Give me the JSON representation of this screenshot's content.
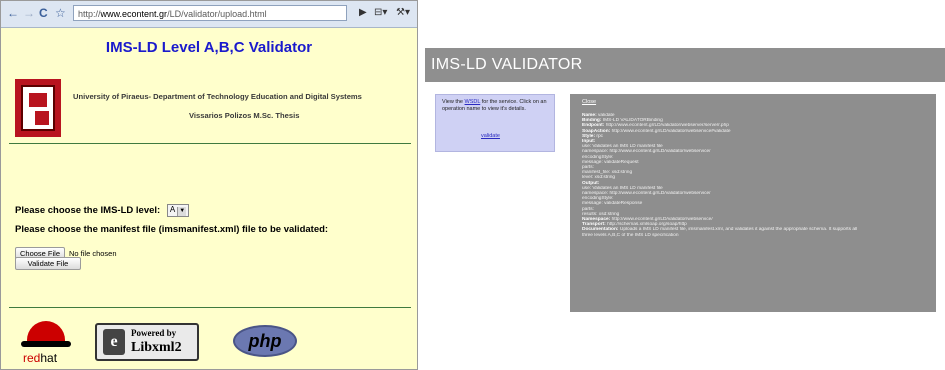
{
  "left": {
    "browser": {
      "back_glyph": "←",
      "forward_glyph": "→",
      "reload_glyph": "C",
      "star_glyph": "☆",
      "url_prefix": "http://",
      "url_host": "www.econtent.gr",
      "url_path": "/LD/validator/upload.html",
      "play_glyph": "▶",
      "page_menu_glyph": "⊟▾",
      "tools_menu_glyph": "⚒▾"
    },
    "title": "IMS-LD Level A,B,C Validator",
    "university": "University of Piraeus- Department of Technology Education and Digital Systems",
    "author": "Vissarios Polizos M.Sc. Thesis",
    "level_label": "Please choose the IMS-LD level:",
    "level_value": "A",
    "file_label": "Please choose the manifest file (imsmanifest.xml) file to be validated:",
    "choose_file_button": "Choose File",
    "no_file_text": "No file chosen",
    "validate_button": "Validate File",
    "badges": {
      "redhat_red": "red",
      "redhat_hat": "hat",
      "libxml_powered": "Powered by",
      "libxml_name": "Libxml2",
      "libxml_icon": "e",
      "php": "php"
    }
  },
  "right": {
    "header_title": "IMS-LD VALIDATOR",
    "info_prefix": "View the ",
    "info_wsdl": "WSDL",
    "info_suffix": " for the service. Click on an operation name to view it's details.",
    "validate_link": "validate",
    "close_link": "Close",
    "details": [
      {
        "k": "Name:",
        "v": " validate"
      },
      {
        "k": "Binding:",
        "v": " IMS-LD VALIDATORBinding"
      },
      {
        "k": "Endpoint:",
        "v": " http://www.econtent.gr/LD/validator/webserver/serverr.php"
      },
      {
        "k": "SoapAction:",
        "v": " http://www.econtent.gr/LD/validator/webservice#validate"
      },
      {
        "k": "Style:",
        "v": " rpc"
      },
      {
        "k": "Input:",
        "v": ""
      },
      {
        "k": "",
        "v": "  use: Validates an IMS LD manifest file"
      },
      {
        "k": "",
        "v": "  namespace: http://www.econtent.gr/LD/validator/webservice/"
      },
      {
        "k": "",
        "v": "  encodingStyle:"
      },
      {
        "k": "",
        "v": "  message: validateRequest"
      },
      {
        "k": "",
        "v": "  parts:"
      },
      {
        "k": "",
        "v": "    manifest_file: xsd:string"
      },
      {
        "k": "",
        "v": "    level: xsd:string"
      },
      {
        "k": "Output:",
        "v": ""
      },
      {
        "k": "",
        "v": "  use: Validates an IMS LD manifest file"
      },
      {
        "k": "",
        "v": "  namespace: http://www.econtent.gr/LD/validator/webservice/"
      },
      {
        "k": "",
        "v": "  encodingStyle:"
      },
      {
        "k": "",
        "v": "  message: validateResponse"
      },
      {
        "k": "",
        "v": "  parts:"
      },
      {
        "k": "",
        "v": "    results: xsd:string"
      },
      {
        "k": "Namespace:",
        "v": " http://www.econtent.gr/LD/validator/webservice/"
      },
      {
        "k": "Transport:",
        "v": " http://schemas.xmlsoap.org/soap/http"
      },
      {
        "k": "Documentation:",
        "v": " Uploads a IMS LD manifest file, imsmanifest.xml, and validates it against the appropriate schema. It supports all"
      },
      {
        "k": "",
        "v": "three levels A,B,C of the IMS LD specification"
      }
    ]
  },
  "colors": {
    "left_bg": "#ffffcc",
    "title_blue": "#1a1acc",
    "divider_green": "#3f7a3f",
    "header_gray": "#8f8f8f",
    "infobox_lilac": "#cfd1f4"
  }
}
